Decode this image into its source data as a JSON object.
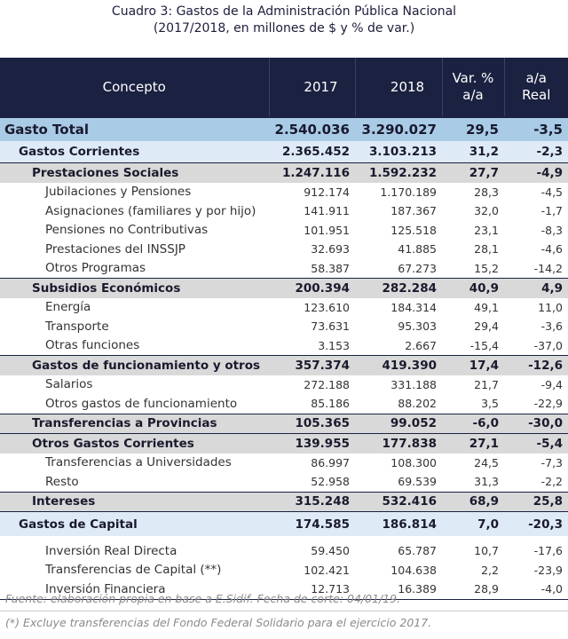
{
  "title_line1": "Cuadro 3: Gastos de la Administración Pública Nacional",
  "title_line2": "(2017/2018, en millones de $ y % de var.)",
  "headers": {
    "concepto": "Concepto",
    "y2017": "2017",
    "y2018": "2018",
    "var_line1": "Var. %",
    "var_line2": "a/a",
    "real_line1": "a/a",
    "real_line2": "Real"
  },
  "rows": [
    {
      "level": 0,
      "label": "Gasto Total",
      "v2017": "2.540.036",
      "v2018": "3.290.027",
      "var": "29,5",
      "real": "-3,5"
    },
    {
      "level": 1,
      "label": "Gastos Corrientes",
      "v2017": "2.365.452",
      "v2018": "3.103.213",
      "var": "31,2",
      "real": "-2,3"
    },
    {
      "level": 2,
      "label": "Prestaciones Sociales",
      "v2017": "1.247.116",
      "v2018": "1.592.232",
      "var": "27,7",
      "real": "-4,9"
    },
    {
      "level": 3,
      "label": "Jubilaciones y Pensiones",
      "v2017": "912.174",
      "v2018": "1.170.189",
      "var": "28,3",
      "real": "-4,5"
    },
    {
      "level": 3,
      "label": "Asignaciones (familiares y por hijo)",
      "v2017": "141.911",
      "v2018": "187.367",
      "var": "32,0",
      "real": "-1,7"
    },
    {
      "level": 3,
      "label": "Pensiones no Contributivas",
      "v2017": "101.951",
      "v2018": "125.518",
      "var": "23,1",
      "real": "-8,3"
    },
    {
      "level": 3,
      "label": "Prestaciones del INSSJP",
      "v2017": "32.693",
      "v2018": "41.885",
      "var": "28,1",
      "real": "-4,6"
    },
    {
      "level": 3,
      "label": "Otros Programas",
      "v2017": "58.387",
      "v2018": "67.273",
      "var": "15,2",
      "real": "-14,2"
    },
    {
      "level": 2,
      "label": "Subsidios Económicos",
      "v2017": "200.394",
      "v2018": "282.284",
      "var": "40,9",
      "real": "4,9"
    },
    {
      "level": 3,
      "label": "Energía",
      "v2017": "123.610",
      "v2018": "184.314",
      "var": "49,1",
      "real": "11,0"
    },
    {
      "level": 3,
      "label": "Transporte",
      "v2017": "73.631",
      "v2018": "95.303",
      "var": "29,4",
      "real": "-3,6"
    },
    {
      "level": 3,
      "label": "Otras funciones",
      "v2017": "3.153",
      "v2018": "2.667",
      "var": "-15,4",
      "real": "-37,0"
    },
    {
      "level": 2,
      "label": "Gastos de funcionamiento y otros",
      "v2017": "357.374",
      "v2018": "419.390",
      "var": "17,4",
      "real": "-12,6"
    },
    {
      "level": 3,
      "label": "Salarios",
      "v2017": "272.188",
      "v2018": "331.188",
      "var": "21,7",
      "real": "-9,4"
    },
    {
      "level": 3,
      "label": "Otros gastos de funcionamiento",
      "v2017": "85.186",
      "v2018": "88.202",
      "var": "3,5",
      "real": "-22,9"
    },
    {
      "level": 2,
      "label": "Transferencias a Provincias",
      "v2017": "105.365",
      "v2018": "99.052",
      "var": "-6,0",
      "real": "-30,0"
    },
    {
      "level": 2,
      "label": "Otros Gastos Corrientes",
      "v2017": "139.955",
      "v2018": "177.838",
      "var": "27,1",
      "real": "-5,4"
    },
    {
      "level": 3,
      "label": "Transferencias a Universidades",
      "v2017": "86.997",
      "v2018": "108.300",
      "var": "24,5",
      "real": "-7,3"
    },
    {
      "level": 3,
      "label": "Resto",
      "v2017": "52.958",
      "v2018": "69.539",
      "var": "31,3",
      "real": "-2,2"
    },
    {
      "level": 2,
      "label": "Intereses",
      "v2017": "315.248",
      "v2018": "532.416",
      "var": "68,9",
      "real": "25,8"
    },
    {
      "level": 1,
      "label": "Gastos de Capital",
      "v2017": "174.585",
      "v2018": "186.814",
      "var": "7,0",
      "real": "-20,3"
    },
    {
      "level": 3,
      "label": "Inversión Real Directa",
      "v2017": "59.450",
      "v2018": "65.787",
      "var": "10,7",
      "real": "-17,6"
    },
    {
      "level": 3,
      "label": "Transferencias de Capital (**)",
      "v2017": "102.421",
      "v2018": "104.638",
      "var": "2,2",
      "real": "-23,9"
    },
    {
      "level": 3,
      "label": "Inversión Financiera",
      "v2017": "12.713",
      "v2018": "16.389",
      "var": "28,9",
      "real": "-4,0"
    }
  ],
  "source_note": "Fuente: elaboración propia en base a E.Sidif. Fecha de corte: 04/01/19.",
  "footnote": "(*) Excluye transferencias del Fondo Federal Solidario para el ejercicio 2017."
}
